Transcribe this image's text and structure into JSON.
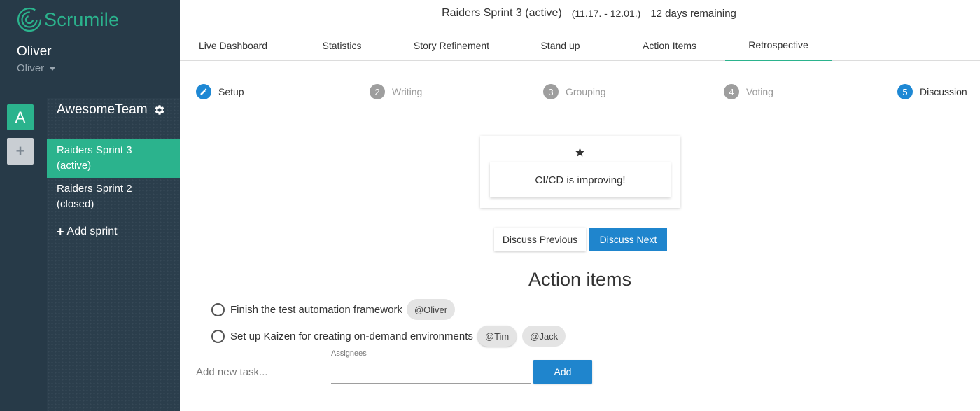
{
  "app": {
    "logo_text": "Scrumile",
    "brand_color": "#2bb38d",
    "accent_color": "#1f85cd"
  },
  "user": {
    "name": "Oliver",
    "account": "Oliver"
  },
  "teams": {
    "active_initial": "A",
    "add_symbol": "+",
    "current_team": "AwesomeTeam",
    "sprints": [
      {
        "line1": "Raiders Sprint 3",
        "line2": "(active)",
        "active": true
      },
      {
        "line1": "Raiders Sprint 2",
        "line2": "(closed)",
        "active": false
      }
    ],
    "add_sprint_label": "Add sprint"
  },
  "header": {
    "sprint_title": "Raiders Sprint 3 (active)",
    "dates": "(11.17. - 12.01.)",
    "remaining": "12 days remaining"
  },
  "tabs": [
    {
      "label": "Live Dashboard"
    },
    {
      "label": "Statistics"
    },
    {
      "label": "Story Refinement"
    },
    {
      "label": "Stand up"
    },
    {
      "label": "Action Items"
    },
    {
      "label": "Retrospective",
      "active": true
    }
  ],
  "stepper": [
    {
      "number": "",
      "label": "Setup",
      "state": "done"
    },
    {
      "number": "2",
      "label": "Writing",
      "state": "pending"
    },
    {
      "number": "3",
      "label": "Grouping",
      "state": "pending"
    },
    {
      "number": "4",
      "label": "Voting",
      "state": "pending"
    },
    {
      "number": "5",
      "label": "Discussion",
      "state": "current"
    }
  ],
  "discussion": {
    "card_text": "CI/CD is improving!",
    "prev_label": "Discuss Previous",
    "next_label": "Discuss Next"
  },
  "action_items": {
    "title": "Action items",
    "items": [
      {
        "text": "Finish the test automation framework",
        "assignees": [
          "@Oliver"
        ]
      },
      {
        "text": "Set up Kaizen for creating on-demand environments",
        "assignees": [
          "@Tim",
          "@Jack"
        ]
      }
    ],
    "new_task_placeholder": "Add new task...",
    "assignees_label": "Assignees",
    "add_label": "Add"
  }
}
